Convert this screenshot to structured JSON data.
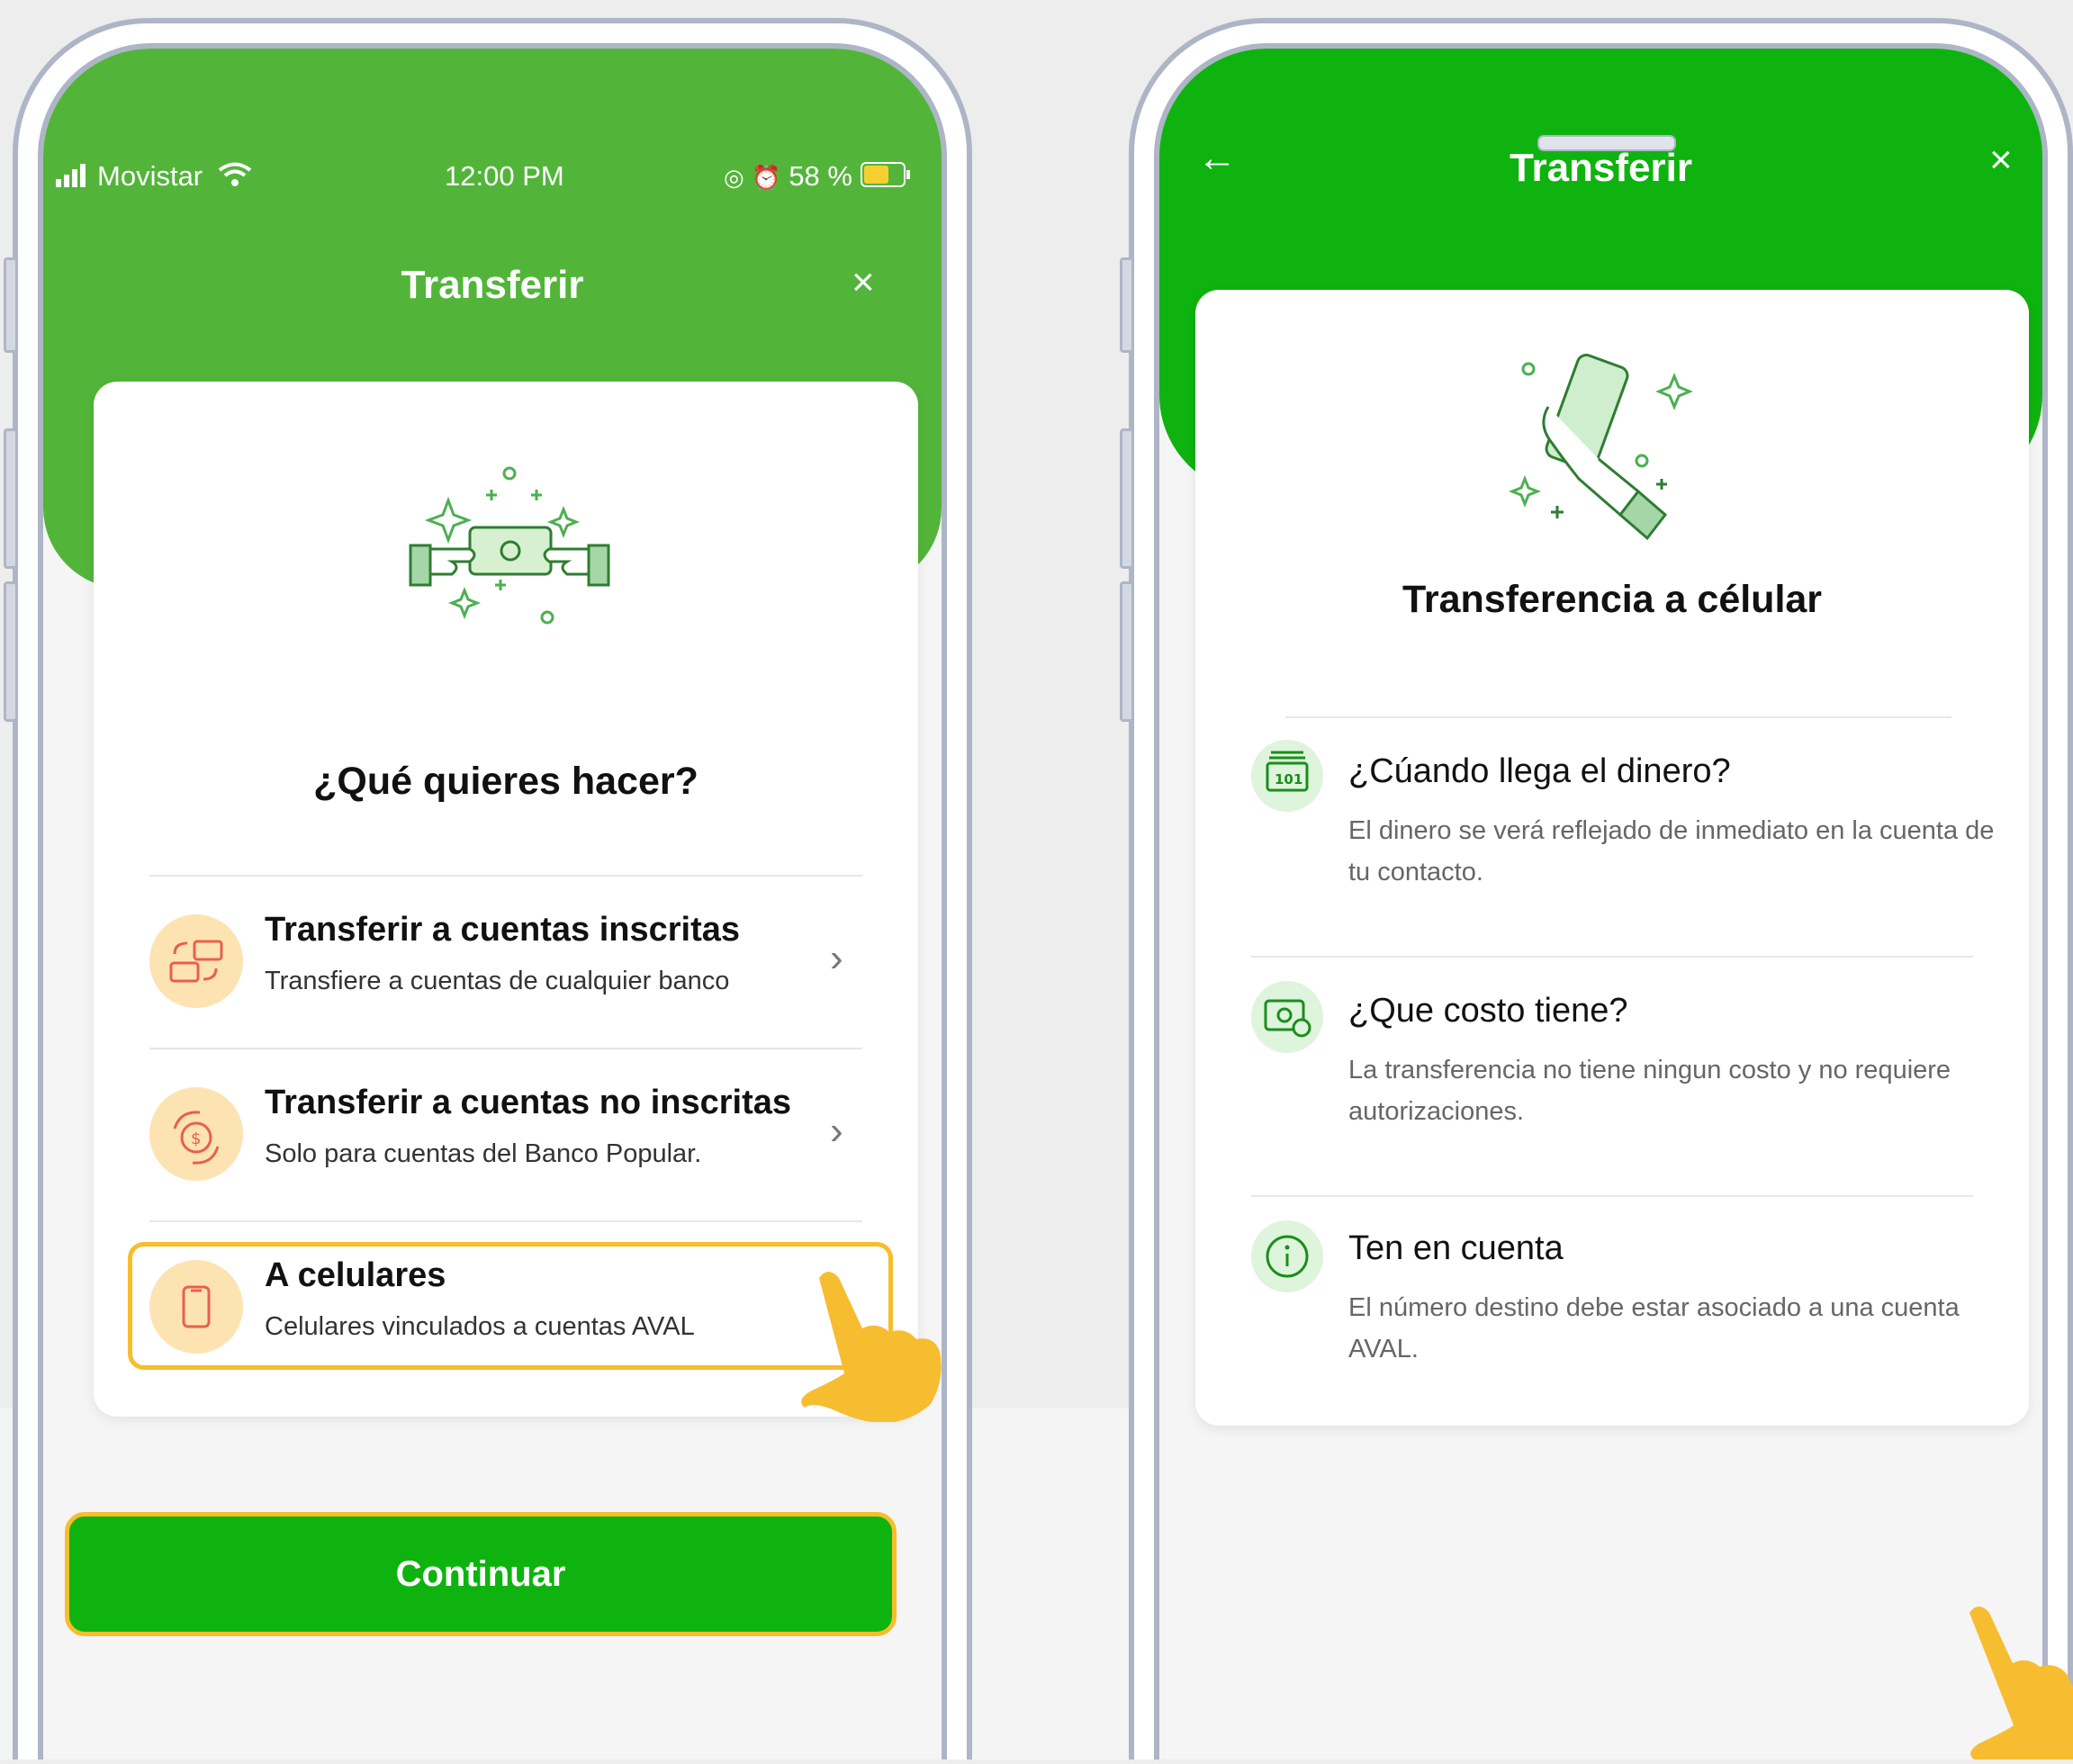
{
  "left_screen": {
    "status_bar": {
      "carrier": "Movistar",
      "time": "12:00 PM",
      "battery": "58 %"
    },
    "header": {
      "title": "Transferir",
      "close": "×"
    },
    "question": "¿Qué quieres hacer?",
    "options": [
      {
        "title": "Transferir a cuentas inscritas",
        "subtitle": "Transfiere a cuentas de cualquier banco",
        "chevron": "›"
      },
      {
        "title": "Transferir a cuentas no inscritas",
        "subtitle": "Solo para cuentas del Banco Popular.",
        "chevron": "›"
      },
      {
        "title": "A celulares",
        "subtitle": "Celulares vinculados a cuentas AVAL",
        "chevron": "›"
      }
    ]
  },
  "right_screen": {
    "header": {
      "title": "Transferir",
      "back": "←",
      "close": "×"
    },
    "heading": "Transferencia a célular",
    "info": [
      {
        "title": "¿Cúando llega el dinero?",
        "body": "El dinero se verá reflejado de inmediato en la cuenta de tu contacto."
      },
      {
        "title": "¿Que costo tiene?",
        "body": "La transferencia no tiene ningun costo y no requiere autorizaciones."
      },
      {
        "title": "Ten en cuenta",
        "body": "El número destino debe estar asociado a una cuenta AVAL."
      }
    ],
    "continue_label": "Continuar"
  },
  "colors": {
    "green_left": "#52b53a",
    "green_right": "#0fb30f",
    "highlight": "#f6bd2c",
    "hand": "#f7bd30"
  }
}
